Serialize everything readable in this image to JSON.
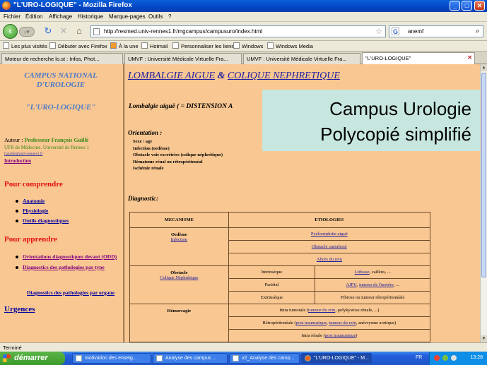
{
  "window": {
    "title": "\"L'URO-LOGIQUE\" - Mozilla Firefox",
    "minimize": "_",
    "maximize": "□",
    "close": "✕"
  },
  "menu": [
    "Fichier",
    "Édition",
    "Affichage",
    "Historique",
    "Marque-pages",
    "Outils",
    "?"
  ],
  "nav": {
    "url": "http://resmed.univ-rennes1.fr/mgcampus/campusuro/index.html",
    "search_engine": "G",
    "search_query": "anemf"
  },
  "bookmarks": [
    "Les plus visités",
    "Débuter avec Firefox",
    "À la une",
    "Hotmail",
    "Personnaliser les liens",
    "Windows",
    "Windows Media"
  ],
  "tabs": [
    {
      "label": "Moteur de recherche lo.st : Infos, Phot..."
    },
    {
      "label": "UMVF : Université Médicale Virtuelle Fra..."
    },
    {
      "label": "UMVF : Université Médicale Virtuelle Fra..."
    },
    {
      "label": "\"L'URO-LOGIQUE\""
    }
  ],
  "sidebar": {
    "campus_title": "CAMPUS NATIONAL D'UROLOGIE",
    "subtitle": "\"L'URO-LOGIQUE\"",
    "auteur_label": "Auteur : ",
    "auteur_name": "Professeur François Guillé",
    "ufr": "UFR de Médecine. Université de Rennes 1",
    "email": "f.guille@univ-rennes1.fr",
    "intro": "Introduction",
    "section_comprendre": "Pour comprendre",
    "comprendre_items": [
      "Anatomie",
      "Physiologie",
      "Outils diagnostiques"
    ],
    "section_apprendre": "Pour apprendre",
    "apprendre_items": [
      "Orientations diagnostiques devant (ODD)",
      "Diagnostics des pathologies par type"
    ],
    "diag_organe": "Diagnostics des pathologies par organe",
    "urgences": "Urgences"
  },
  "main": {
    "heading_1": "LOMBALGIE AIGUE",
    "heading_amp": "&",
    "heading_2": "COLIQUE NEPHRETIQUE",
    "definition": "Lombalgie aiguë ( = DISTENSION A",
    "orientation_label": "Orientation :",
    "orientation_items": [
      "Sexe / age",
      "Infection (oedème)",
      "Obstacle voie excrétrice (colique néphrétique)",
      "Hématome rénal ou rétropéritonéal",
      "Ischémie rénale"
    ],
    "diagnostic_label": "Diagnostic:"
  },
  "overlay": {
    "line1": "Campus Urologie",
    "line2": "Polycopié simplifié"
  },
  "table": {
    "headers": [
      "MECANISME",
      "ETIOLOGIES"
    ],
    "oedeme": "Oedème",
    "infection": "Infection",
    "pyelo": "Pyélonéphrite aiguë",
    "obstacle_surinfecte": "Obstacle surinfecté",
    "abces": "Abcès du rein",
    "obstacle": "Obstacle",
    "colique": "Colique Néphrétique",
    "intrinseque": "Intrinsèque",
    "lithiase": "Lithiase",
    "lithiase_rest": ", caillots, ...",
    "parietal": "Pariétal",
    "ajpu": "AJPU",
    "tumeur_uretere": "tumeur de l'uretère",
    "parietal_rest": ", ...",
    "extrinseque": "Extrinsèque",
    "fibrose": "Fibrose ou tumeur rétropéritonéale",
    "hemorragie": "Hémorragie",
    "intra_tumorale_a": "Intra tumorale (",
    "tumeur_rein": "tumeur du rein",
    "intra_tumorale_b": ", polykystose rénale, ...)",
    "retro_a": "Rétropéritonéale (",
    "post_trauma": "post traumatique",
    "retro_sep": ", ",
    "tumeur_rein_2": "tumeur du rein",
    "retro_b": ", anévrysme aortique)",
    "intra_renale_a": "Intra rénale (",
    "post_trauma_2": "post traumatique",
    "intra_renale_b": ")"
  },
  "status": "Terminé",
  "taskbar": {
    "start": "démarrer",
    "tasks": [
      "motivation des enseig...",
      "Analyse des campus ...",
      "v2_Analyse des camp...",
      "\"L'URO-LOGIQUE\" - M..."
    ],
    "lang": "FR",
    "clock": "13:28"
  },
  "colors": {
    "page_bg": "#f9c792",
    "heading_link": "#2020a0",
    "section_red": "#e01010",
    "overlay_bg": "#c7e6e0"
  }
}
